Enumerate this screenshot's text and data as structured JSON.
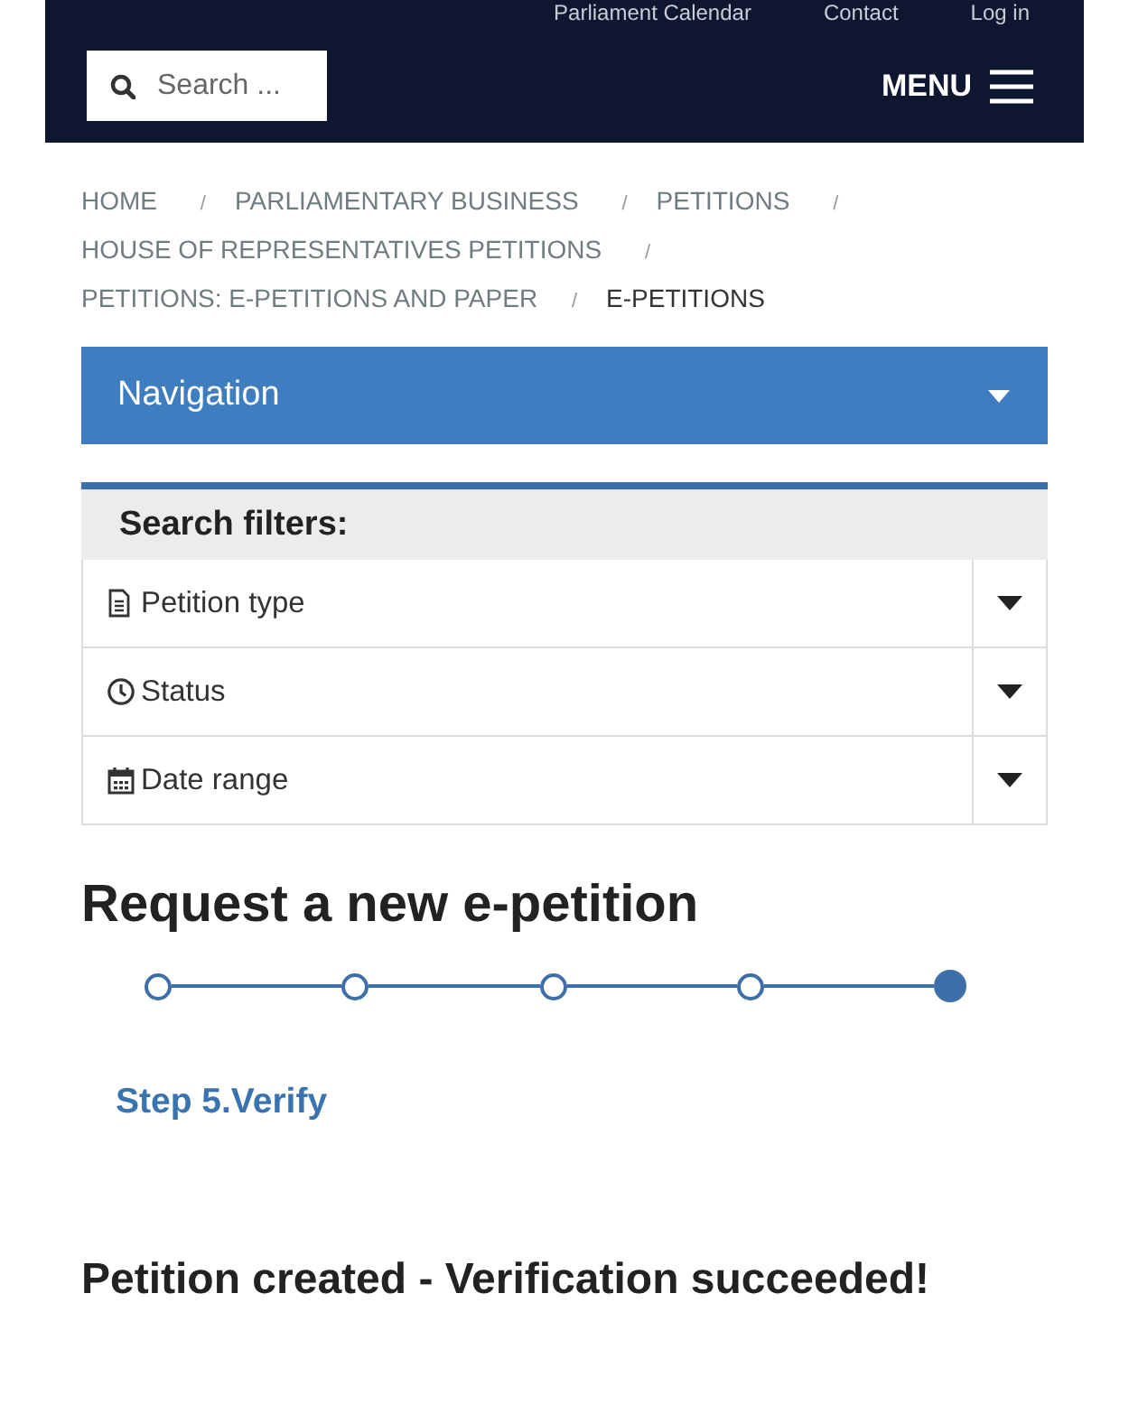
{
  "header": {
    "top_links": [
      "Parliament Calendar",
      "Contact",
      "Log in"
    ],
    "search": {
      "placeholder": "Search ..."
    },
    "menu_label": "MENU"
  },
  "breadcrumbs": [
    {
      "label": "HOME",
      "current": false
    },
    {
      "label": "PARLIAMENTARY BUSINESS",
      "current": false
    },
    {
      "label": "PETITIONS",
      "current": false
    },
    {
      "label": "HOUSE OF REPRESENTATIVES PETITIONS",
      "current": false
    },
    {
      "label": "PETITIONS: E-PETITIONS AND PAPER",
      "current": false
    },
    {
      "label": "E-PETITIONS",
      "current": true
    }
  ],
  "breadcrumb_separator": "/",
  "navigation": {
    "label": "Navigation",
    "expanded": false
  },
  "filters": {
    "title": "Search filters:",
    "items": [
      {
        "label": "Petition type",
        "kind": "document",
        "expanded": false
      },
      {
        "label": "Status",
        "kind": "clock",
        "expanded": false
      },
      {
        "label": "Date range",
        "kind": "calendar",
        "expanded": false
      }
    ]
  },
  "wizard": {
    "title": "Request a new e-petition",
    "steps": [
      {
        "current": false
      },
      {
        "current": false
      },
      {
        "current": false
      },
      {
        "current": false
      },
      {
        "current": true
      }
    ],
    "step_label": "Step 5.Verify"
  },
  "result": "Petition created - Verification succeeded!"
}
